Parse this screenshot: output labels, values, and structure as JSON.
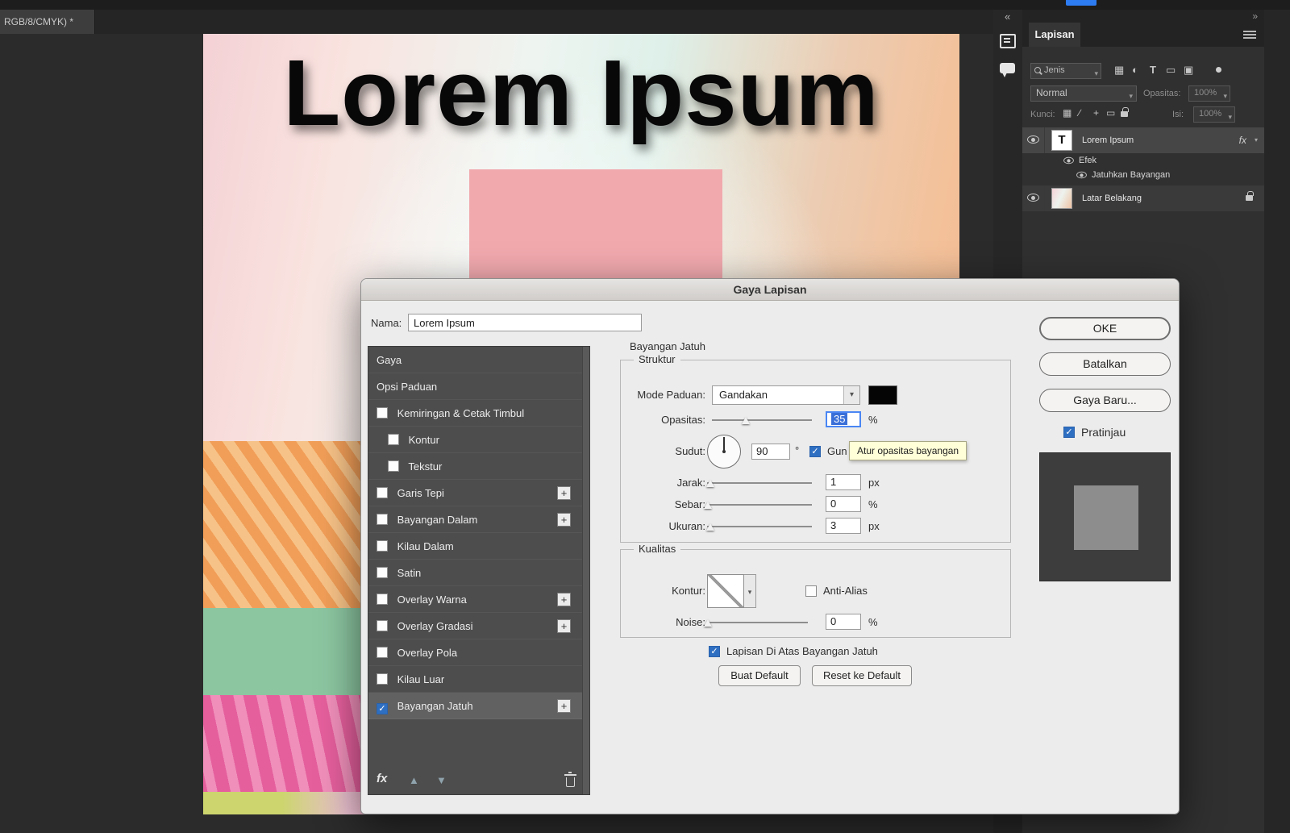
{
  "icons": {
    "chevron_down": "▾",
    "double_chevron_left": "«",
    "double_chevron_right": "»",
    "up_arrow": "▲",
    "down_arrow": "▼",
    "plus": "+",
    "check": "✓"
  },
  "app": {
    "doc_tab": "RGB/8/CMYK) *",
    "accent_blue": "#2e7cf2"
  },
  "canvas": {
    "headline": "Lorem Ipsum"
  },
  "dialog": {
    "title": "Gaya Lapisan",
    "name_label": "Nama:",
    "name_value": "Lorem Ipsum",
    "styles": [
      {
        "label": "Gaya"
      },
      {
        "label": "Opsi Paduan"
      },
      {
        "label": "Kemiringan & Cetak Timbul",
        "checkbox": true,
        "checked": false
      },
      {
        "label": "Kontur",
        "checkbox": true,
        "checked": false,
        "indent": true
      },
      {
        "label": "Tekstur",
        "checkbox": true,
        "checked": false,
        "indent": true
      },
      {
        "label": "Garis Tepi",
        "checkbox": true,
        "checked": false,
        "plus": true
      },
      {
        "label": "Bayangan Dalam",
        "checkbox": true,
        "checked": false,
        "plus": true
      },
      {
        "label": "Kilau Dalam",
        "checkbox": true,
        "checked": false
      },
      {
        "label": "Satin",
        "checkbox": true,
        "checked": false
      },
      {
        "label": "Overlay Warna",
        "checkbox": true,
        "checked": false,
        "plus": true
      },
      {
        "label": "Overlay Gradasi",
        "checkbox": true,
        "checked": false,
        "plus": true
      },
      {
        "label": "Overlay Pola",
        "checkbox": true,
        "checked": false
      },
      {
        "label": "Kilau Luar",
        "checkbox": true,
        "checked": false
      },
      {
        "label": "Bayangan Jatuh",
        "checkbox": true,
        "checked": true,
        "plus": true,
        "selected": true
      }
    ],
    "fx_glyph": "fx",
    "section_title": "Bayangan Jatuh",
    "struktur": {
      "legend": "Struktur",
      "mode_label": "Mode Paduan:",
      "mode_value": "Gandakan",
      "opacity_label": "Opasitas:",
      "opacity_value": "35",
      "opacity_unit": "%",
      "opacity_slider_pct": 34,
      "angle_label": "Sudut:",
      "angle_value": "90",
      "angle_unit": "°",
      "use_global_visible": "Gun",
      "use_global_checked": true,
      "distance_label": "Jarak:",
      "distance_value": "1",
      "distance_unit": "px",
      "distance_slider_pct": 3,
      "spread_label": "Sebar:",
      "spread_value": "0",
      "spread_unit": "%",
      "spread_slider_pct": 1,
      "size_label": "Ukuran:",
      "size_value": "3",
      "size_unit": "px",
      "size_slider_pct": 3
    },
    "kualitas": {
      "legend": "Kualitas",
      "contour_label": "Kontur:",
      "anti_alias_label": "Anti-Alias",
      "anti_alias_checked": false,
      "noise_label": "Noise:",
      "noise_value": "0",
      "noise_unit": "%",
      "noise_slider_pct": 1
    },
    "knockout_label": "Lapisan Di Atas Bayangan Jatuh",
    "knockout_checked": true,
    "buat_default": "Buat Default",
    "reset_default": "Reset ke Default",
    "ok": "OKE",
    "cancel": "Batalkan",
    "new_style": "Gaya Baru...",
    "preview_label": "Pratinjau",
    "preview_checked": true,
    "tooltip": "Atur opasitas bayangan"
  },
  "layers_panel": {
    "tab": "Lapisan",
    "filter_label": "Jenis",
    "filter_icons": [
      {
        "name": "pixel-layer-filter-icon",
        "glyph": "▦"
      },
      {
        "name": "adjustment-layer-filter-icon",
        "glyph": "◐"
      },
      {
        "name": "type-layer-filter-icon",
        "glyph": "T"
      },
      {
        "name": "shape-layer-filter-icon",
        "glyph": "▭"
      },
      {
        "name": "smart-object-filter-icon",
        "glyph": "▣"
      }
    ],
    "blend_mode": "Normal",
    "opacity_label": "Opasitas:",
    "opacity_value": "100%",
    "lock_label": "Kunci:",
    "lock_icons": [
      {
        "name": "lock-transparency-icon",
        "glyph": "▦"
      },
      {
        "name": "lock-pixels-icon",
        "glyph": "∕"
      },
      {
        "name": "lock-position-icon",
        "glyph": "+"
      },
      {
        "name": "lock-artboard-icon",
        "glyph": "▭"
      }
    ],
    "fill_label": "Isi:",
    "fill_value": "100%",
    "layer1_name": "Lorem Ipsum",
    "layer1_thumb": "T",
    "layer1_fx": "fx",
    "effects_header": "Efek",
    "effect_item": "Jatuhkan Bayangan",
    "layer2_name": "Latar Belakang"
  }
}
